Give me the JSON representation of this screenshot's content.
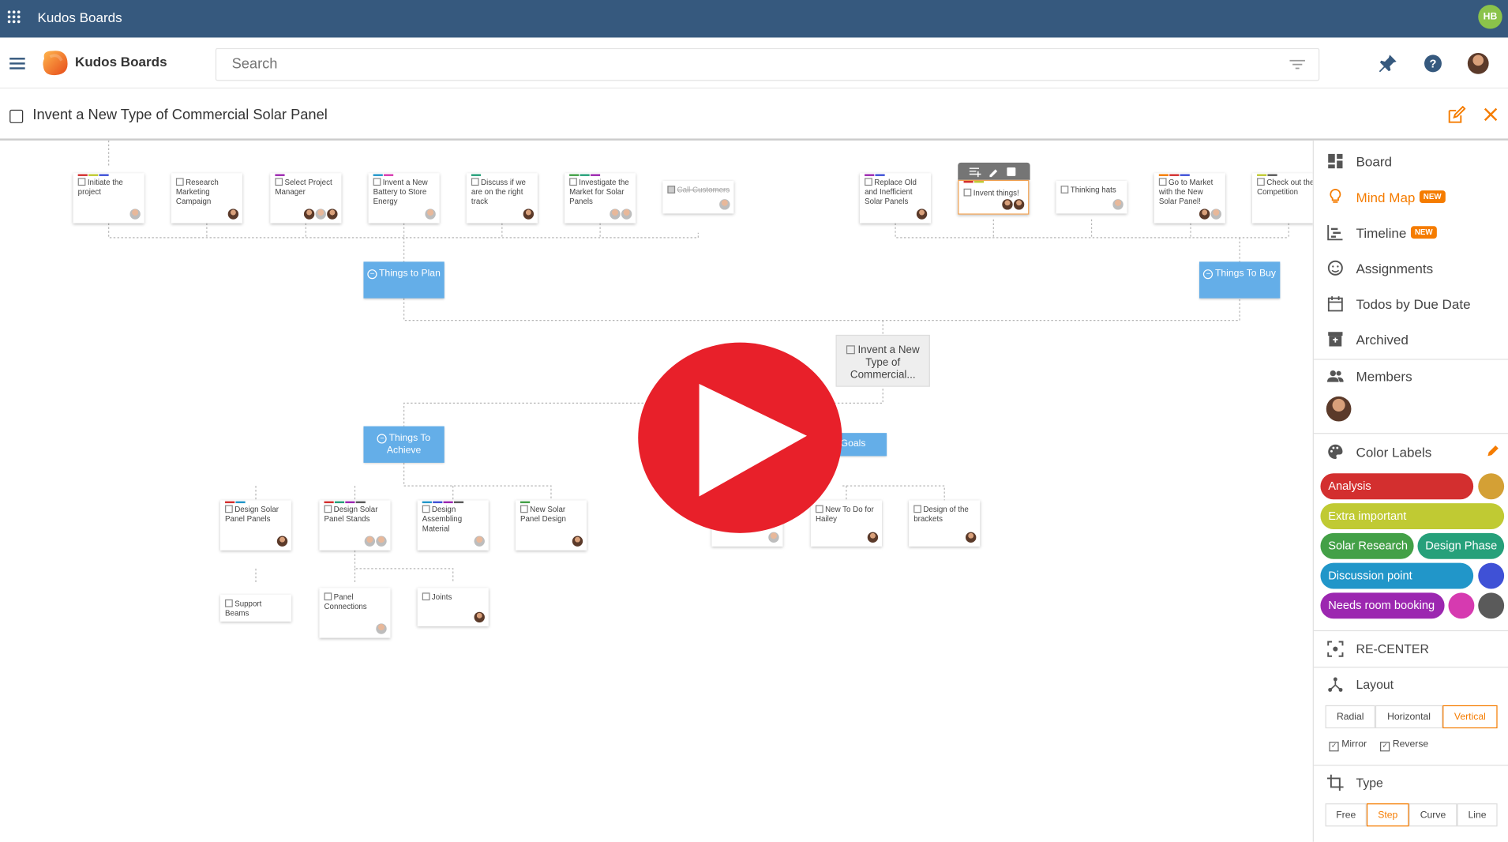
{
  "app_title": "Kudos Boards",
  "user_initials": "HB",
  "header": {
    "brand": "Kudos Boards",
    "search_placeholder": "Search"
  },
  "board": {
    "title": "Invent a New Type of Commercial Solar Panel"
  },
  "mindmap": {
    "center": "Invent a New Type of Commercial...",
    "groups": [
      {
        "label": "Things to Plan"
      },
      {
        "label": "Things To Buy"
      },
      {
        "label": "Things To Achieve"
      },
      {
        "label": "Goals"
      }
    ],
    "cards_plan": [
      "Initiate the project",
      "Research Marketing Campaign",
      "Select Project Manager",
      "Invent a New Battery to Store Energy",
      "Discuss if we are on the right track",
      "Investigate the Market for Solar Panels",
      "Call Customers"
    ],
    "cards_buy": [
      "Replace Old and Inefficient Solar Panels",
      "Invent things!",
      "Thinking hats",
      "Go to Market with the New Solar Panel!",
      "Check out the Competition"
    ],
    "cards_achieve": [
      "Design Solar Panel Panels",
      "Design Solar Panel Stands",
      "Design Assembling Material",
      "New Solar Panel Design"
    ],
    "cards_stands": [
      "Support Beams",
      "Panel Connections",
      "Joints"
    ],
    "cards_goals": [
      "New To Do for Hailey",
      "Design of the brackets"
    ]
  },
  "panel": {
    "nav": [
      {
        "label": "Board",
        "icon": "board-icon"
      },
      {
        "label": "Mind Map",
        "icon": "lightbulb-icon",
        "badge": "NEW",
        "active": true
      },
      {
        "label": "Timeline",
        "icon": "timeline-icon",
        "badge": "NEW"
      },
      {
        "label": "Assignments",
        "icon": "assignments-icon"
      },
      {
        "label": "Todos by Due Date",
        "icon": "calendar-icon"
      },
      {
        "label": "Archived",
        "icon": "archive-icon"
      }
    ],
    "members_label": "Members",
    "color_labels_title": "Color Labels",
    "labels": {
      "analysis": "Analysis",
      "extra_important": "Extra important",
      "solar_research": "Solar Research",
      "design_phase": "Design Phase",
      "discussion_point": "Discussion point",
      "needs_room": "Needs room booking"
    },
    "label_colors": {
      "analysis": "#d32f2f",
      "extra_important": "#c0ca33",
      "solar_research": "#43a047",
      "design_phase": "#26a07a",
      "discussion_point": "#2196c9",
      "needs_room": "#9c27b0",
      "dot_gold": "#d4a035",
      "dot_blue": "#3f51d6",
      "dot_pink": "#d63ab0",
      "dot_gray": "#5a5a5a"
    },
    "recenter": "RE-CENTER",
    "layout_title": "Layout",
    "layout_options": [
      "Radial",
      "Horizontal",
      "Vertical"
    ],
    "layout_selected": "Vertical",
    "mirror": "Mirror",
    "reverse": "Reverse",
    "type_title": "Type",
    "type_options": [
      "Free",
      "Step",
      "Curve",
      "Line"
    ],
    "type_selected": "Step"
  }
}
